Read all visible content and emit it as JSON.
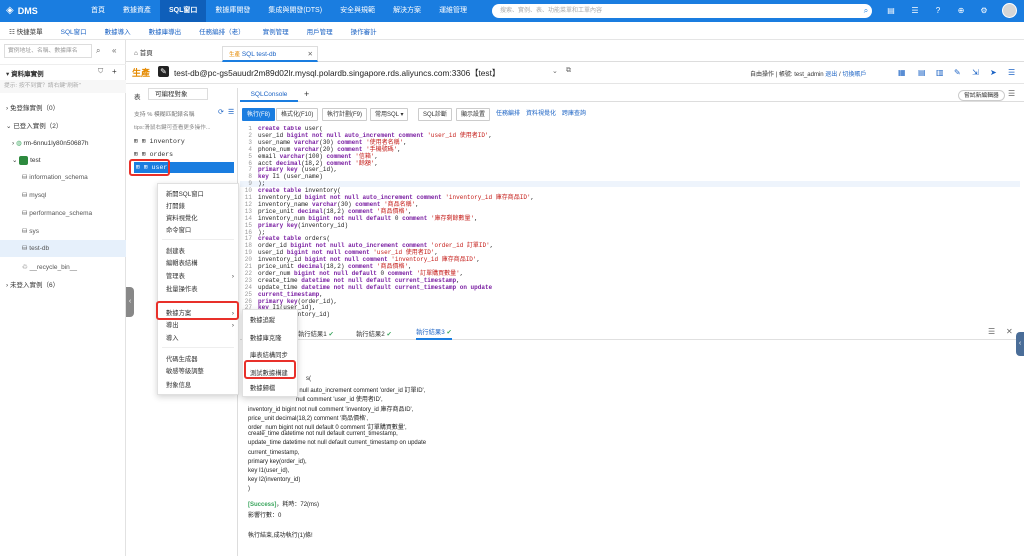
{
  "brand": {
    "name": "DMS"
  },
  "nav": [
    "首頁",
    "數據資產",
    "SQL窗口",
    "數據庫開發",
    "集成與開發(DTS)",
    "安全與規範",
    "解決方案",
    "運維管理"
  ],
  "search_placeholder": "搜索、實例、表、功能菜單和工單內容",
  "menubar": [
    "快捷菜單",
    "SQL窗口",
    "數據導入",
    "數據庫導出",
    "任務編排（老）",
    "實例管理",
    "用戶管理",
    "操作審計"
  ],
  "sidebar": {
    "search_placeholder": "實例地址、名稱、數據庫名",
    "title": "資料庫實例",
    "hint": "提示: 按不到實？請右鍵\"刷新\"",
    "items": [
      {
        "label": "免登錄實例（0）"
      },
      {
        "label": "已登入實例（2）"
      },
      {
        "label": "rm-6nnu1ly80n50687h"
      },
      {
        "label": "test"
      },
      {
        "label": "information_schema"
      },
      {
        "label": "mysql"
      },
      {
        "label": "performance_schema"
      },
      {
        "label": "sys"
      },
      {
        "label": "test-db"
      },
      {
        "label": "__recycle_bin__"
      },
      {
        "label": "未登入實例（6）"
      }
    ]
  },
  "file_tabs": {
    "home": "首頁",
    "active_prefix": "生產",
    "active": "SQL test-db"
  },
  "connection": {
    "env": "生產",
    "name": "test-db@pc-gs5auudr2m89d02lr.mysql.polardb.singapore.rds.aliyuncs.com:3306【test】",
    "mode": "自由操作",
    "account_label": "帳號: test_admin",
    "logout": "退出",
    "switch": "切換賬戶"
  },
  "objpanel": {
    "tabs": [
      "表",
      "可編程對象"
    ],
    "filter_placeholder": "支持 % 模糊匹配錶名稱",
    "tip": "tips:滑鼠右鍵可查看更多操作...",
    "tables": [
      "inventory",
      "orders",
      "user"
    ]
  },
  "ctx1": [
    "新開SQL窗口",
    "打開錶",
    "資料視覺化",
    "命令窗口",
    "創建表",
    "編輯表結構",
    "管理表",
    "批量操作表",
    "數據方案",
    "導出",
    "導入",
    "代碼生成器",
    "敏感等級調整",
    "對象信息"
  ],
  "ctx2": [
    "數據追蹤",
    "數據庫克隆",
    "庫表結構同步",
    "測試數據構建",
    "數據歸檔"
  ],
  "editor": {
    "tab": "SQLConsole",
    "new_editor": "嘗試新編輯器",
    "buttons": [
      "執行(F8)",
      "格式化(F10)",
      "執行計劃(F9)",
      "常用SQL ▾",
      "SQL診斷",
      "顯示設置"
    ],
    "links": [
      "任務編排",
      "資料視覺化",
      "跨庫查詢"
    ]
  },
  "code_lines": [
    "create table user(",
    "user_id bigint not null auto_increment comment 'user_id 使用者ID',",
    "user_name varchar(30) comment '使用者名稱',",
    "phone_num varchar(20) comment '手機號碼',",
    "email varchar(100) comment '信箱',",
    "acct decimal(18,2) comment '餘額',",
    "primary key (user_id),",
    "key I1 (user_name)",
    ");",
    "create table inventory(",
    "inventory_id bigint not null auto_increment comment 'inventory_id 庫存商品ID',",
    "inventory_name varchar(30) comment '商品名稱',",
    "price_unit decimal(18,2) comment '商品價格',",
    "inventory_num bigint not null default 0 comment '庫存剩餘數量',",
    "primary key(inventory_id)",
    ");",
    "create table orders(",
    "order_id bigint not null auto_increment comment 'order_id 訂單ID',",
    "user_id bigint not null comment 'user_id 使用者ID',",
    "inventory_id bigint not null comment 'inventory_id 庫存商品ID',",
    "price_unit decimal(18,2) comment '商品價格',",
    "order_num bigint not null default 0 comment '訂單購買數量',",
    "create_time datetime not null default current_timestamp,",
    "update_time datetime not null default current_timestamp on update",
    "current_timestamp,",
    "primary key(order_id),",
    "key I1(user_id),",
    "key I2(inventory_id)"
  ],
  "results": {
    "tabs": [
      "執行結果1",
      "執行結果2",
      "執行結果3"
    ],
    "lines": [
      "s(",
      "t null auto_increment comment 'order_id 訂單ID',",
      "null comment 'user_id 使用者ID',",
      "inventory_id bigint not null comment 'inventory_id 庫存商品ID',",
      "price_unit decimal(18,2) comment '商品價格',",
      "order_num bigint not null default 0 comment '訂單購買數量',",
      "create_time datetime not null default current_timestamp,",
      "update_time datetime not null default current_timestamp on update",
      "current_timestamp,",
      "primary key(order_id),",
      "key I1(user_id),",
      "key I2(inventory_id)",
      ")"
    ],
    "success": "[Success]",
    "elapsed": "，耗時：72(ms)",
    "affected": "影響行數：0",
    "done": "執行結束,成功執行(1)條!"
  },
  "colors": {
    "primary": "#1a7de0",
    "highlight": "#e8302a",
    "link": "#1a62c4"
  }
}
